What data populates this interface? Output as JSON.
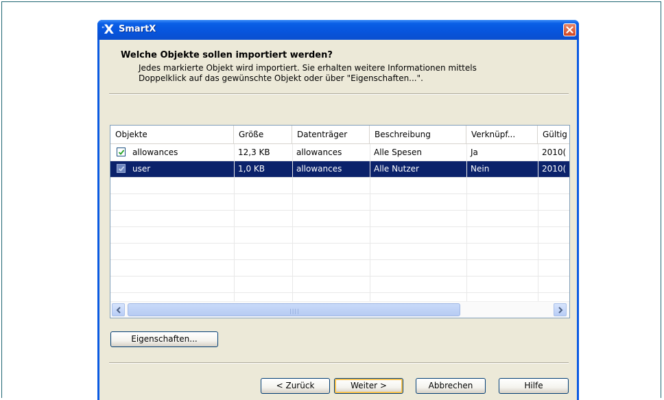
{
  "window": {
    "title": "SmartX",
    "icon": "smartx-logo-icon"
  },
  "heading": "Welche Objekte sollen importiert werden?",
  "description": [
    "Jedes markierte Objekt wird importiert. Sie erhalten weitere Informationen mittels",
    "Doppelklick auf das gewünschte Objekt oder über \"Eigenschaften...\"."
  ],
  "table": {
    "columns": [
      "Objekte",
      "Größe",
      "Datenträger",
      "Beschreibung",
      "Verknüpf...",
      "Gültig"
    ],
    "rows": [
      {
        "checked": true,
        "selected": false,
        "cells": [
          "allowances",
          "12,3 KB",
          "allowances",
          "Alle Spesen",
          "Ja",
          "2010("
        ]
      },
      {
        "checked": true,
        "selected": true,
        "cells": [
          "user",
          "1,0 KB",
          "allowances",
          "Alle Nutzer",
          "Nein",
          "2010("
        ]
      }
    ]
  },
  "buttons": {
    "properties": "Eigenschaften...",
    "back": "< Zurück",
    "next": "Weiter >",
    "cancel": "Abbrechen",
    "help": "Hilfe"
  },
  "colors": {
    "titlebar": "#0754dc",
    "selection": "#0b226b",
    "dialog_bg": "#ece9d8"
  }
}
